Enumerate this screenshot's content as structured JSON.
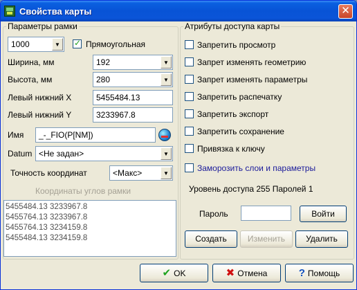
{
  "window": {
    "title": "Свойства карты",
    "close_glyph": "✕"
  },
  "frame_params": {
    "legend": "Параметры рамки",
    "scale_value": "1000",
    "rectangular_label": "Прямоугольная",
    "rectangular_checked": true,
    "width_label": "Ширина, мм",
    "width_value": "192",
    "height_label": "Высота, мм",
    "height_value": "280",
    "left_bottom_x_label": "Левый нижний X",
    "left_bottom_x_value": "5455484.13",
    "left_bottom_y_label": "Левый нижний Y",
    "left_bottom_y_value": "3233967.8",
    "name_label": "Имя",
    "name_value": "_-_FIO(P[NM])",
    "datum_label": "Datum",
    "datum_value": "<Не задан>",
    "precision_label": "Точность координат",
    "precision_value": "<Макс>",
    "corners_title": "Координаты углов рамки",
    "corners": [
      "5455484.13 3233967.8",
      "5455764.13 3233967.8",
      "5455764.13 3234159.8",
      "5455484.13 3234159.8"
    ]
  },
  "access": {
    "legend": "Атрибуты доступа карты",
    "options": [
      {
        "label": "Запретить просмотр",
        "checked": false
      },
      {
        "label": "Запрет изменять геометрию",
        "checked": false
      },
      {
        "label": "Запрет изменять параметры",
        "checked": false
      },
      {
        "label": "Запретить распечатку",
        "checked": false
      },
      {
        "label": "Запретить экспорт",
        "checked": false
      },
      {
        "label": "Запретить сохранение",
        "checked": false
      },
      {
        "label": "Привязка к ключу",
        "checked": false
      }
    ],
    "freeze_label": "Заморозить слои и параметры",
    "freeze_checked": false,
    "level_text": "Уровень доступа 255 Паролей 1",
    "password_label": "Пароль",
    "password_value": "",
    "login_button": "Войти",
    "create_button": "Создать",
    "change_button": "Изменить",
    "delete_button": "Удалить"
  },
  "footer": {
    "ok_button": "OK",
    "cancel_button": "Отмена",
    "help_button": "Помощь"
  },
  "colors": {
    "titlebar": "#0853d6",
    "freeze_label": "#1a1a9a",
    "disabled_text": "#a5a195",
    "ok_check": "#1fa31f",
    "cancel_x": "#d01010",
    "help_q": "#1050c0"
  }
}
